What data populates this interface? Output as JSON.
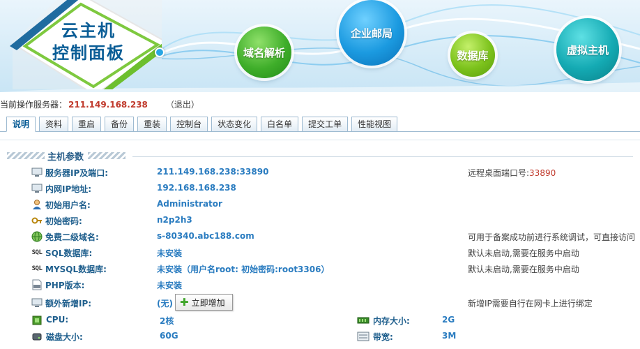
{
  "banner": {
    "logo_line1": "云主机",
    "logo_line2": "控制面板",
    "nav": [
      "域名解析",
      "企业邮局",
      "数据库",
      "虚拟主机"
    ]
  },
  "server": {
    "label": "当前操作服务器：",
    "ip": "211.149.168.238",
    "logout": "（退出）"
  },
  "tabs": [
    "说明",
    "资料",
    "重启",
    "备份",
    "重装",
    "控制台",
    "状态变化",
    "白名单",
    "提交工单",
    "性能视图"
  ],
  "section": {
    "title": "主机参数"
  },
  "rows": [
    {
      "label": "服务器IP及端口:",
      "value": "211.149.168.238:33890",
      "note": "远程桌面端口号:",
      "note_port": "33890",
      "icon": "monitor-icon"
    },
    {
      "label": "内网IP地址:",
      "value": "192.168.168.238",
      "note": "",
      "icon": "monitor-icon"
    },
    {
      "label": "初始用户名:",
      "value": "Administrator",
      "note": "",
      "icon": "user-icon"
    },
    {
      "label": "初始密码:",
      "value": "n2p2h3",
      "note": "",
      "icon": "key-icon"
    },
    {
      "label": "免费二级域名:",
      "value": "s-80340.abc188.com",
      "note": "可用于备案成功前进行系统调试，可直接访问",
      "icon": "globe-icon"
    },
    {
      "label": "SQL数据库:",
      "value": "未安装",
      "note": "默认未启动,需要在服务中启动",
      "icon": "sql-icon",
      "icon_text": "SQL"
    },
    {
      "label": "MYSQL数据库:",
      "value": "未安装（用户名root: 初始密码:root3306）",
      "note": "默认未启动,需要在服务中启动",
      "icon": "sql-icon",
      "icon_text": "SQL"
    },
    {
      "label": "PHP版本:",
      "value": "未安装",
      "note": "",
      "icon": "php-icon"
    },
    {
      "label": "额外新增IP:",
      "value": "(无)",
      "note": "新增IP需要自行在网卡上进行绑定",
      "icon": "monitor-icon"
    }
  ],
  "add_button": "立即增加",
  "specs": [
    {
      "label": "CPU:",
      "value": "2核",
      "r_label": "内存大小:",
      "r_value": "2G"
    },
    {
      "label": "磁盘大小:",
      "value": "60G",
      "r_label": "带宽:",
      "r_value": "3M"
    }
  ]
}
